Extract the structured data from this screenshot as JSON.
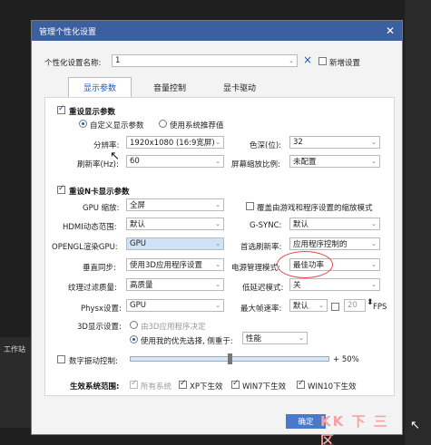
{
  "background": {
    "left_label": "工作站"
  },
  "dialog": {
    "title": "管理个性化设置",
    "profile_label": "个性化设置名称:",
    "profile_value": "1",
    "delete_mark": "×",
    "new_label": "新增设置"
  },
  "tabs": [
    "显示参数",
    "音量控制",
    "显卡驱动"
  ],
  "display": {
    "reset_label": "重设显示参数",
    "radio_custom": "自定义显示参数",
    "radio_recommended": "使用系统推荐值",
    "resolution_label": "分辨率:",
    "resolution_value": "1920x1080 (16:9宽屏)",
    "color_depth_label": "色深(位):",
    "color_depth_value": "32",
    "refresh_label": "刷新率(Hz):",
    "refresh_value": "60",
    "scaling_label": "屏幕缩放比例:",
    "scaling_value": "未配置"
  },
  "nvidia": {
    "reset_label": "重设N卡显示参数",
    "gpu_scaling_label": "GPU 缩放:",
    "gpu_scaling_value": "全屏",
    "override_scaling_label": "覆盖由游戏和程序设置的缩放模式",
    "hdmi_label": "HDMI动态范围:",
    "hdmi_value": "默认",
    "gsync_label": "G-SYNC:",
    "gsync_value": "默认",
    "opengl_label": "OPENGL渲染GPU:",
    "opengl_value": "GPU",
    "preferred_refresh_label": "首选刷新率:",
    "preferred_refresh_value": "应用程序控制的",
    "vsync_label": "垂直同步:",
    "vsync_value": "使用3D应用程序设置",
    "power_label": "电源管理模式:",
    "power_value": "最佳功率",
    "texture_label": "纹理过滤质量:",
    "texture_value": "高质量",
    "low_latency_label": "低延迟模式:",
    "low_latency_value": "关",
    "physx_label": "Physx设置:",
    "physx_value": "GPU",
    "max_fps_label": "最大帧速率:",
    "max_fps_mode": "默认",
    "max_fps_value": "20",
    "fps_unit": "FPS",
    "d3_label": "3D显示设置:",
    "d3_radio_app": "由3D应用程序决定",
    "d3_radio_pref": "使用我的优先选择, 侧重于:",
    "d3_pref_value": "性能"
  },
  "vibrance": {
    "label": "数字振动控制:",
    "value": "+ 50%",
    "level": 0.5
  },
  "scope": {
    "label": "生效系统范围:",
    "all": "所有系统",
    "xp": "XP下生效",
    "win7": "WIN7下生效",
    "win10": "WIN10下生效"
  },
  "footer": {
    "ok": "确定",
    "watermark": "KK 下 三 区"
  },
  "colors": {
    "title_bar": "#3c5fa0",
    "accent": "#1a57c8",
    "annotation": "#e24c4c"
  }
}
